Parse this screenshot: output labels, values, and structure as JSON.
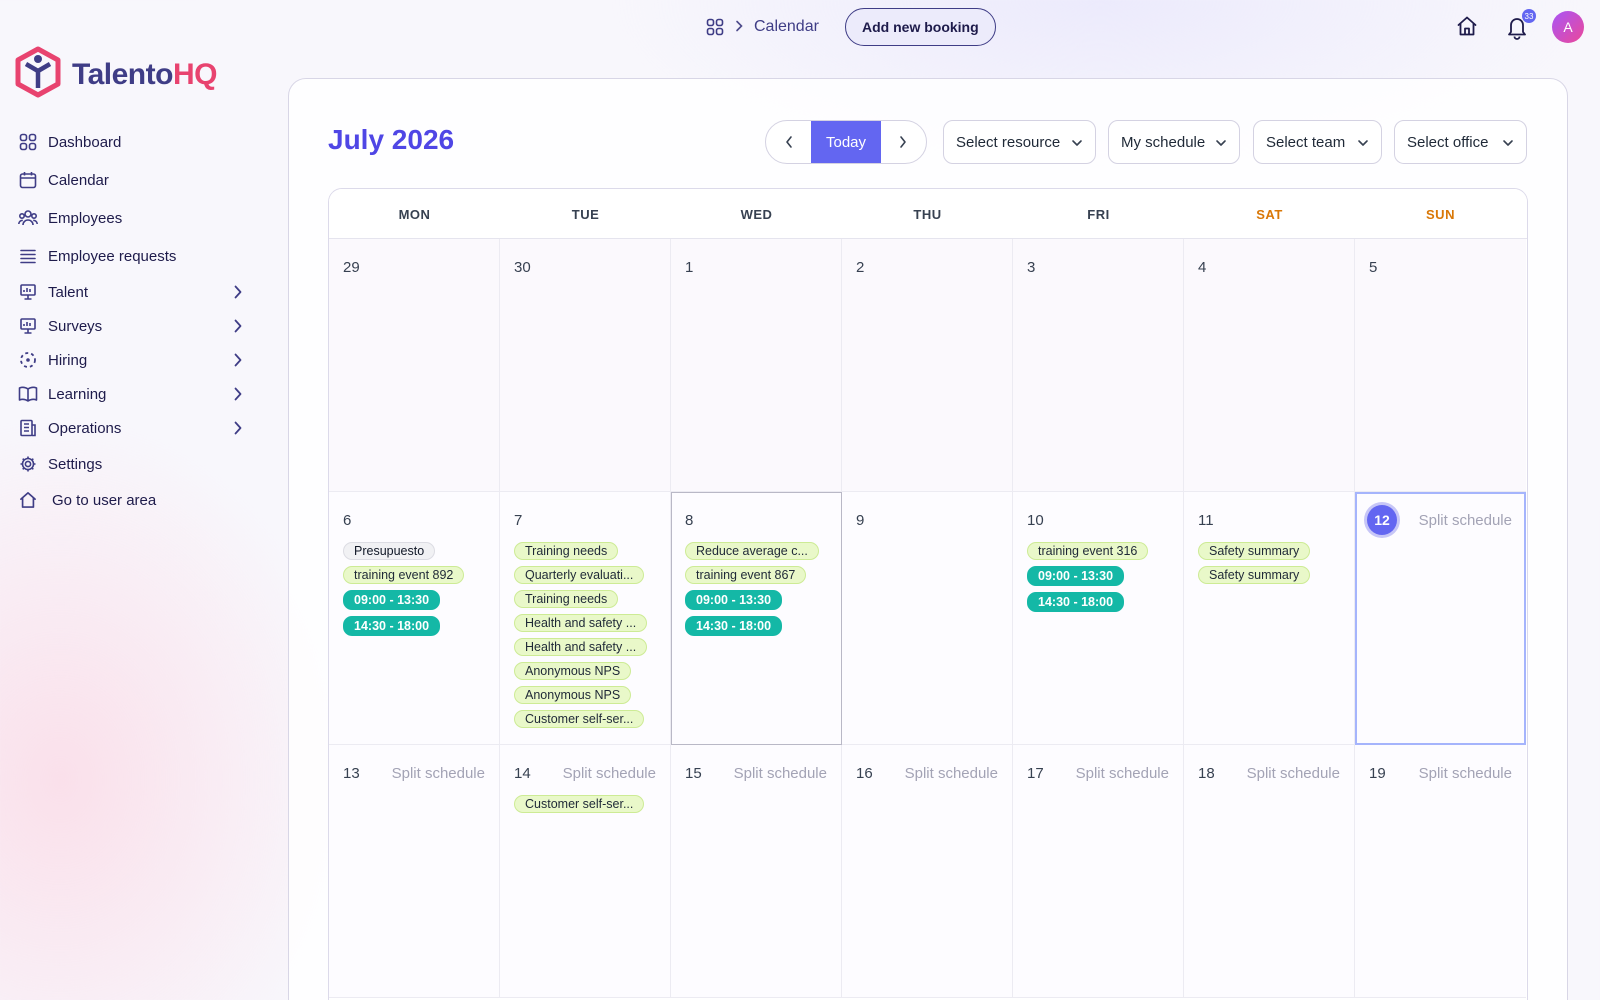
{
  "app": {
    "logo_main": "Talento",
    "logo_accent": "HQ"
  },
  "header": {
    "breadcrumb": "Calendar",
    "add_booking": "Add new booking",
    "notification_count": "33",
    "avatar_initial": "A"
  },
  "sidebar": {
    "items": [
      {
        "label": "Dashboard",
        "icon": "dashboard-icon"
      },
      {
        "label": "Calendar",
        "icon": "calendar-icon"
      },
      {
        "label": "Employees",
        "icon": "employees-icon"
      },
      {
        "label": "Employee requests",
        "icon": "requests-icon"
      },
      {
        "label": "Talent",
        "icon": "talent-icon"
      },
      {
        "label": "Surveys",
        "icon": "surveys-icon"
      },
      {
        "label": "Hiring",
        "icon": "hiring-icon"
      },
      {
        "label": "Learning",
        "icon": "learning-icon"
      },
      {
        "label": "Operations",
        "icon": "operations-icon"
      },
      {
        "label": "Settings",
        "icon": "settings-icon"
      },
      {
        "label": "Go to user area",
        "icon": "home-icon"
      }
    ]
  },
  "calendar": {
    "month_title": "July 2026",
    "today_label": "Today",
    "filters": {
      "resource": "Select resource",
      "schedule": "My schedule",
      "team": "Select team",
      "office": "Select office"
    },
    "weekdays": [
      "MON",
      "TUE",
      "WED",
      "THU",
      "FRI",
      "SAT",
      "SUN"
    ],
    "split_label": "Split schedule",
    "weeks": [
      {
        "days": [
          {
            "num": "29",
            "events": []
          },
          {
            "num": "30",
            "events": []
          },
          {
            "num": "1",
            "events": []
          },
          {
            "num": "2",
            "events": []
          },
          {
            "num": "3",
            "events": []
          },
          {
            "num": "4",
            "events": []
          },
          {
            "num": "5",
            "events": []
          }
        ]
      },
      {
        "days": [
          {
            "num": "6",
            "events": [
              {
                "text": "Presupuesto",
                "kind": "grey"
              },
              {
                "text": "training event 892",
                "kind": "green"
              },
              {
                "text": "09:00 - 13:30",
                "kind": "teal"
              },
              {
                "text": "14:30 - 18:00",
                "kind": "teal"
              }
            ]
          },
          {
            "num": "7",
            "events": [
              {
                "text": "Training needs",
                "kind": "green"
              },
              {
                "text": "Quarterly evaluati...",
                "kind": "green"
              },
              {
                "text": "Training needs",
                "kind": "green"
              },
              {
                "text": "Health and safety ...",
                "kind": "green"
              },
              {
                "text": "Health and safety ...",
                "kind": "green"
              },
              {
                "text": "Anonymous NPS",
                "kind": "green"
              },
              {
                "text": "Anonymous NPS",
                "kind": "green"
              },
              {
                "text": "Customer self-ser...",
                "kind": "green"
              }
            ]
          },
          {
            "num": "8",
            "events": [
              {
                "text": "Reduce average c...",
                "kind": "green"
              },
              {
                "text": "training event 867",
                "kind": "green"
              },
              {
                "text": "09:00 - 13:30",
                "kind": "teal"
              },
              {
                "text": "14:30 - 18:00",
                "kind": "teal"
              }
            ]
          },
          {
            "num": "9",
            "events": []
          },
          {
            "num": "10",
            "events": [
              {
                "text": "training event 316",
                "kind": "green"
              },
              {
                "text": "09:00 - 13:30",
                "kind": "teal"
              },
              {
                "text": "14:30 - 18:00",
                "kind": "teal"
              }
            ]
          },
          {
            "num": "11",
            "events": [
              {
                "text": "Safety summary",
                "kind": "green"
              },
              {
                "text": "Safety summary",
                "kind": "green"
              }
            ]
          },
          {
            "num": "12",
            "today": true,
            "split": true,
            "events": []
          }
        ]
      },
      {
        "days": [
          {
            "num": "13",
            "split": true,
            "events": []
          },
          {
            "num": "14",
            "split": true,
            "events": [
              {
                "text": "Customer self-ser...",
                "kind": "green"
              }
            ]
          },
          {
            "num": "15",
            "split": true,
            "events": []
          },
          {
            "num": "16",
            "split": true,
            "events": []
          },
          {
            "num": "17",
            "split": true,
            "events": []
          },
          {
            "num": "18",
            "split": true,
            "events": []
          },
          {
            "num": "19",
            "split": true,
            "events": []
          }
        ]
      }
    ]
  }
}
